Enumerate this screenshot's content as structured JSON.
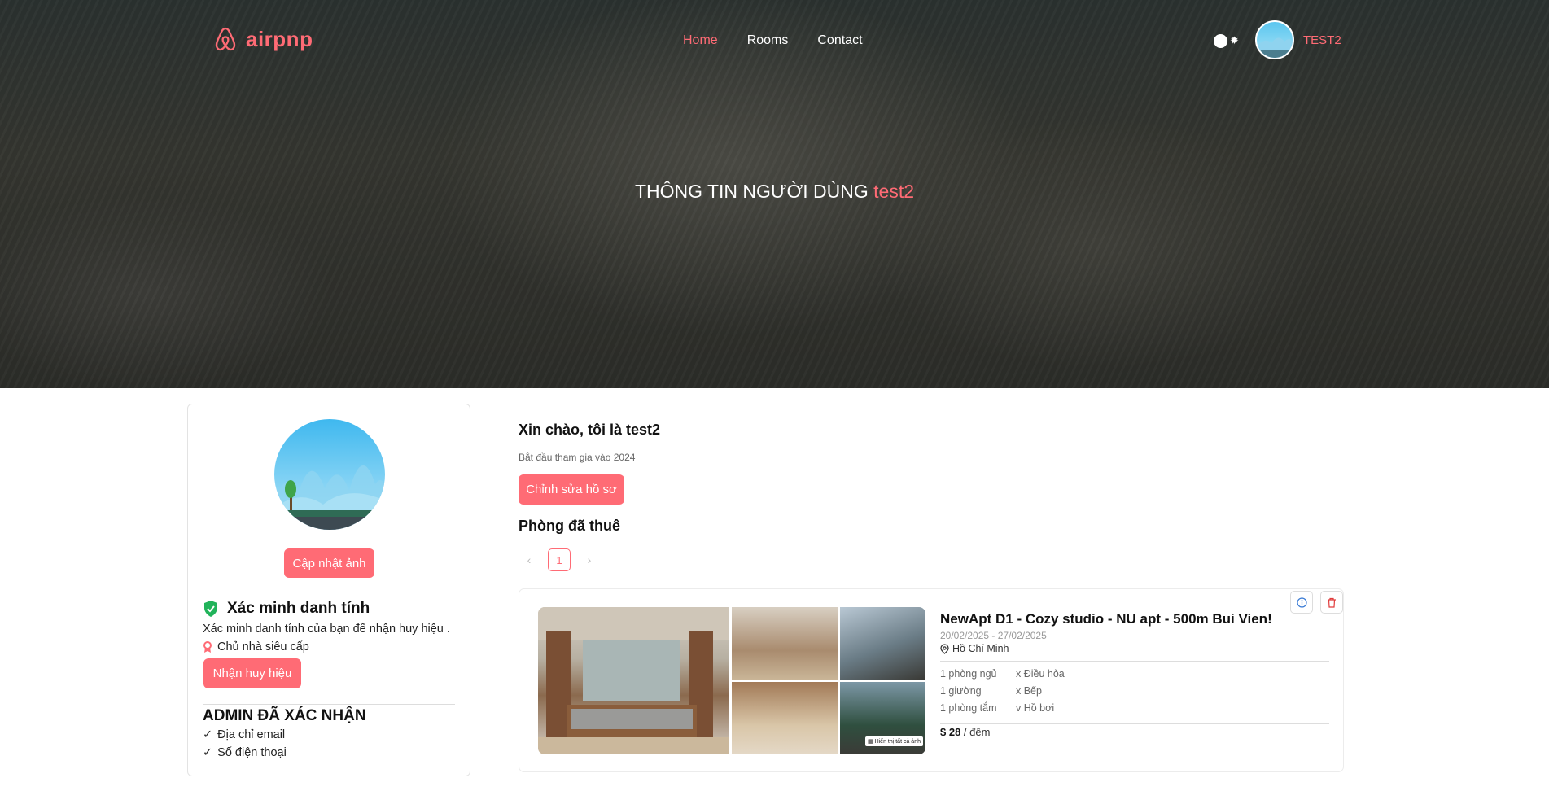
{
  "nav": {
    "brand": "airpnp",
    "menu": [
      {
        "label": "Home",
        "active": true
      },
      {
        "label": "Rooms",
        "active": false
      },
      {
        "label": "Contact",
        "active": false
      }
    ],
    "user_name": "TEST2"
  },
  "hero": {
    "title_prefix": "THÔNG TIN NGƯỜI DÙNG",
    "title_user": "test2"
  },
  "profile_card": {
    "update_photo_label": "Cập nhật ảnh",
    "verify_title": "Xác minh danh tính",
    "verify_desc": "Xác minh danh tính của bạn để nhận huy hiệu .",
    "superhost_label": "Chủ nhà siêu cấp",
    "get_badge_label": "Nhận huy hiệu",
    "admin_title": "ADMIN ĐÃ XÁC NHẬN",
    "confirmed": [
      "Địa chỉ email",
      "Số điện thoại"
    ]
  },
  "main": {
    "greeting": "Xin chào, tôi là test2",
    "joined": "Bắt đầu tham gia vào 2024",
    "edit_profile_label": "Chỉnh sửa hồ sơ",
    "rented_title": "Phòng đã thuê",
    "current_page": "1"
  },
  "room": {
    "title": "NewApt D1 - Cozy studio - NU apt - 500m Bui Vien!",
    "dates": "20/02/2025 - 27/02/2025",
    "location": "Hồ Chí Minh",
    "specs_left": [
      "1 phòng ngủ",
      "1 giường",
      "1 phòng tắm"
    ],
    "specs_right": [
      "x Điều hòa",
      "x Bếp",
      "v Hồ bơi"
    ],
    "price": "$ 28",
    "price_unit": " / đêm",
    "show_all": "Hiển thị tất cả ảnh"
  },
  "colors": {
    "accent": "#ff6b75",
    "verify_green": "#21b35a"
  }
}
